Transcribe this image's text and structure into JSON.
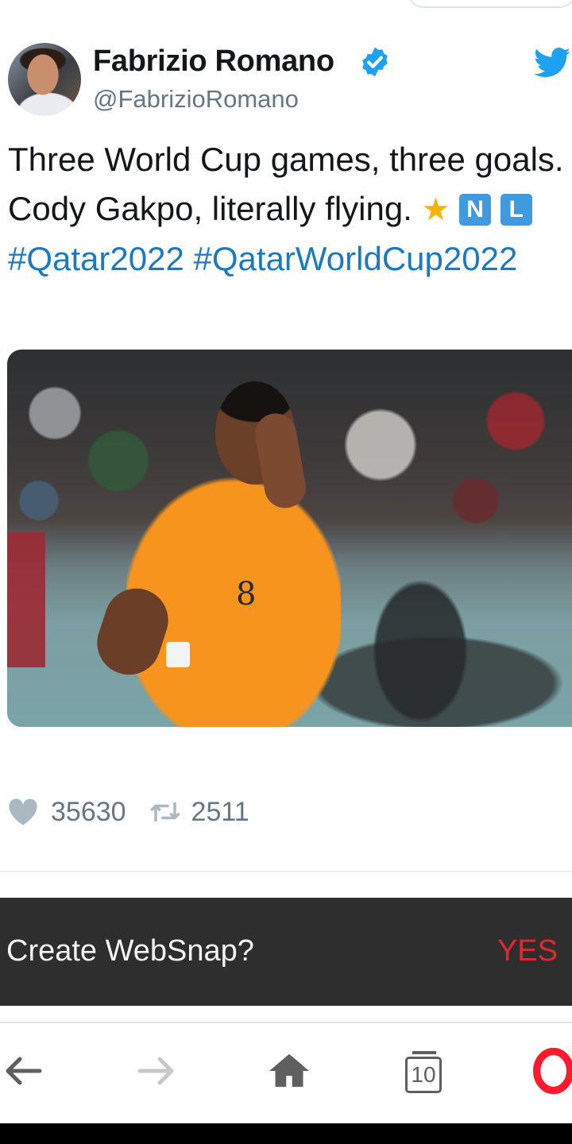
{
  "tweet": {
    "author_name": "Fabrizio Romano",
    "author_handle": "@FabrizioRomano",
    "text_main": "Three World Cup games, three goals. Cody Gakpo, literally flying.",
    "emoji_star": "★",
    "flag_letter_1": "N",
    "flag_letter_2": "L",
    "hashtag_1": "#Qatar2022",
    "hashtag_2": "#QatarWorldCup2022",
    "likes": "35630",
    "retweets": "2511",
    "number_on_shirt": "8"
  },
  "icons": {
    "verified": "verified-badge-icon",
    "twitter": "twitter-bird-icon",
    "like": "heart-icon",
    "retweet": "retweet-icon"
  },
  "snackbar": {
    "message": "Create WebSnap?",
    "action": "YES"
  },
  "browser_nav": {
    "tabs_count": "10"
  },
  "colors": {
    "hashtag": "#1b7abf",
    "verified": "#1da1f2",
    "snackbar_bg": "#2e2e2e",
    "snackbar_action": "#e6262f",
    "opera_red": "#ff1b2d"
  }
}
